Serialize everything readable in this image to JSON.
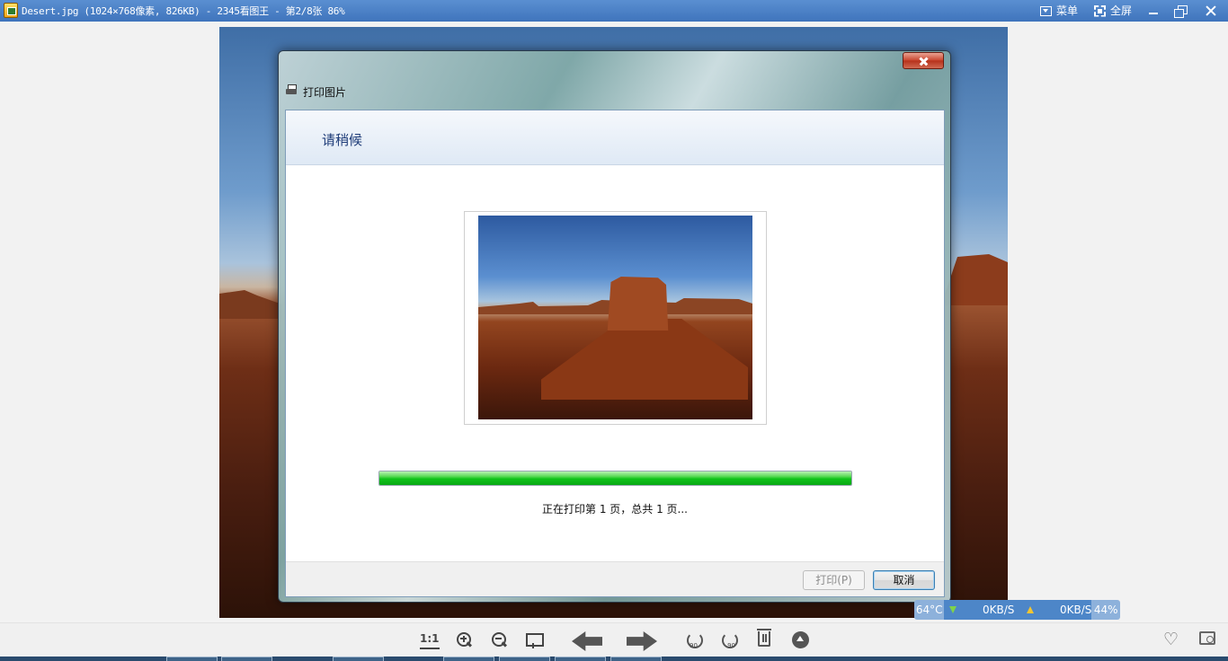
{
  "window": {
    "title": "Desert.jpg (1024×768像素, 826KB) - 2345看图王 - 第2/8张 86%",
    "menu_label": "菜单",
    "fullscreen_label": "全屏"
  },
  "dialog": {
    "title": "打印图片",
    "heading": "请稍候",
    "status_text": "正在打印第 1 页，总共 1 页...",
    "progress_percent": 100,
    "print_button_label": "打印(P)",
    "cancel_button_label": "取消"
  },
  "monitor": {
    "temperature": "64°C",
    "download_speed": "0KB/S",
    "upload_speed": "0KB/S",
    "usage": "44%"
  },
  "toolbar": {
    "actual_size_label": "1:1",
    "rotate_left_label": "90",
    "rotate_right_label": "90",
    "icons": [
      "actual-size",
      "zoom-in-icon",
      "zoom-out-icon",
      "fit-screen-icon",
      "prev-arrow-icon",
      "next-arrow-icon",
      "rotate-left-icon",
      "rotate-right-icon",
      "delete-icon",
      "up-icon",
      "heart-icon",
      "folder-search-icon"
    ]
  },
  "colors": {
    "titlebar": "#4a80c6",
    "progress": "#10c31a",
    "dialog_heading": "#1e3c78"
  }
}
